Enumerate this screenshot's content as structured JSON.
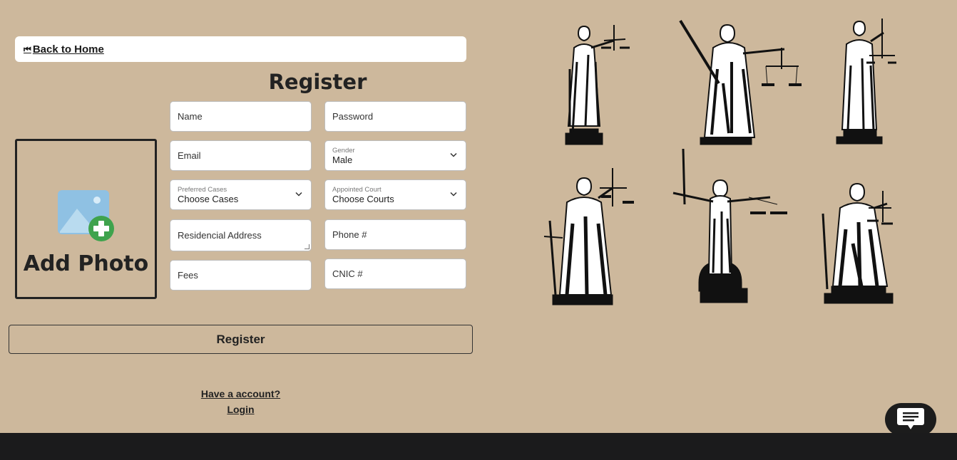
{
  "nav": {
    "back_icon": "⏮",
    "back_label": "Back to Home"
  },
  "form": {
    "title": "Register",
    "photo_label": "Add Photo",
    "fields": {
      "name": "Name",
      "password": "Password",
      "email": "Email",
      "address": "Residencial Address",
      "phone": "Phone #",
      "fees": "Fees",
      "cnic": "CNIC #"
    },
    "selects": {
      "gender": {
        "label": "Gender",
        "value": "Male"
      },
      "cases": {
        "label": "Preferred Cases",
        "value": "Choose Cases"
      },
      "court": {
        "label": "Appointed Court",
        "value": "Choose Courts"
      }
    },
    "submit_label": "Register",
    "have_account": "Have a account?",
    "login_label": "Login"
  },
  "icons": {
    "back": "back-icon",
    "photo": "add-photo-icon",
    "chevron": "chevron-down-icon",
    "chat": "chat-icon"
  },
  "colors": {
    "background": "#cdb89c",
    "footer": "#1b1b1c",
    "accent_green": "#3fa34d",
    "photo_blue": "#8fc1e3"
  }
}
